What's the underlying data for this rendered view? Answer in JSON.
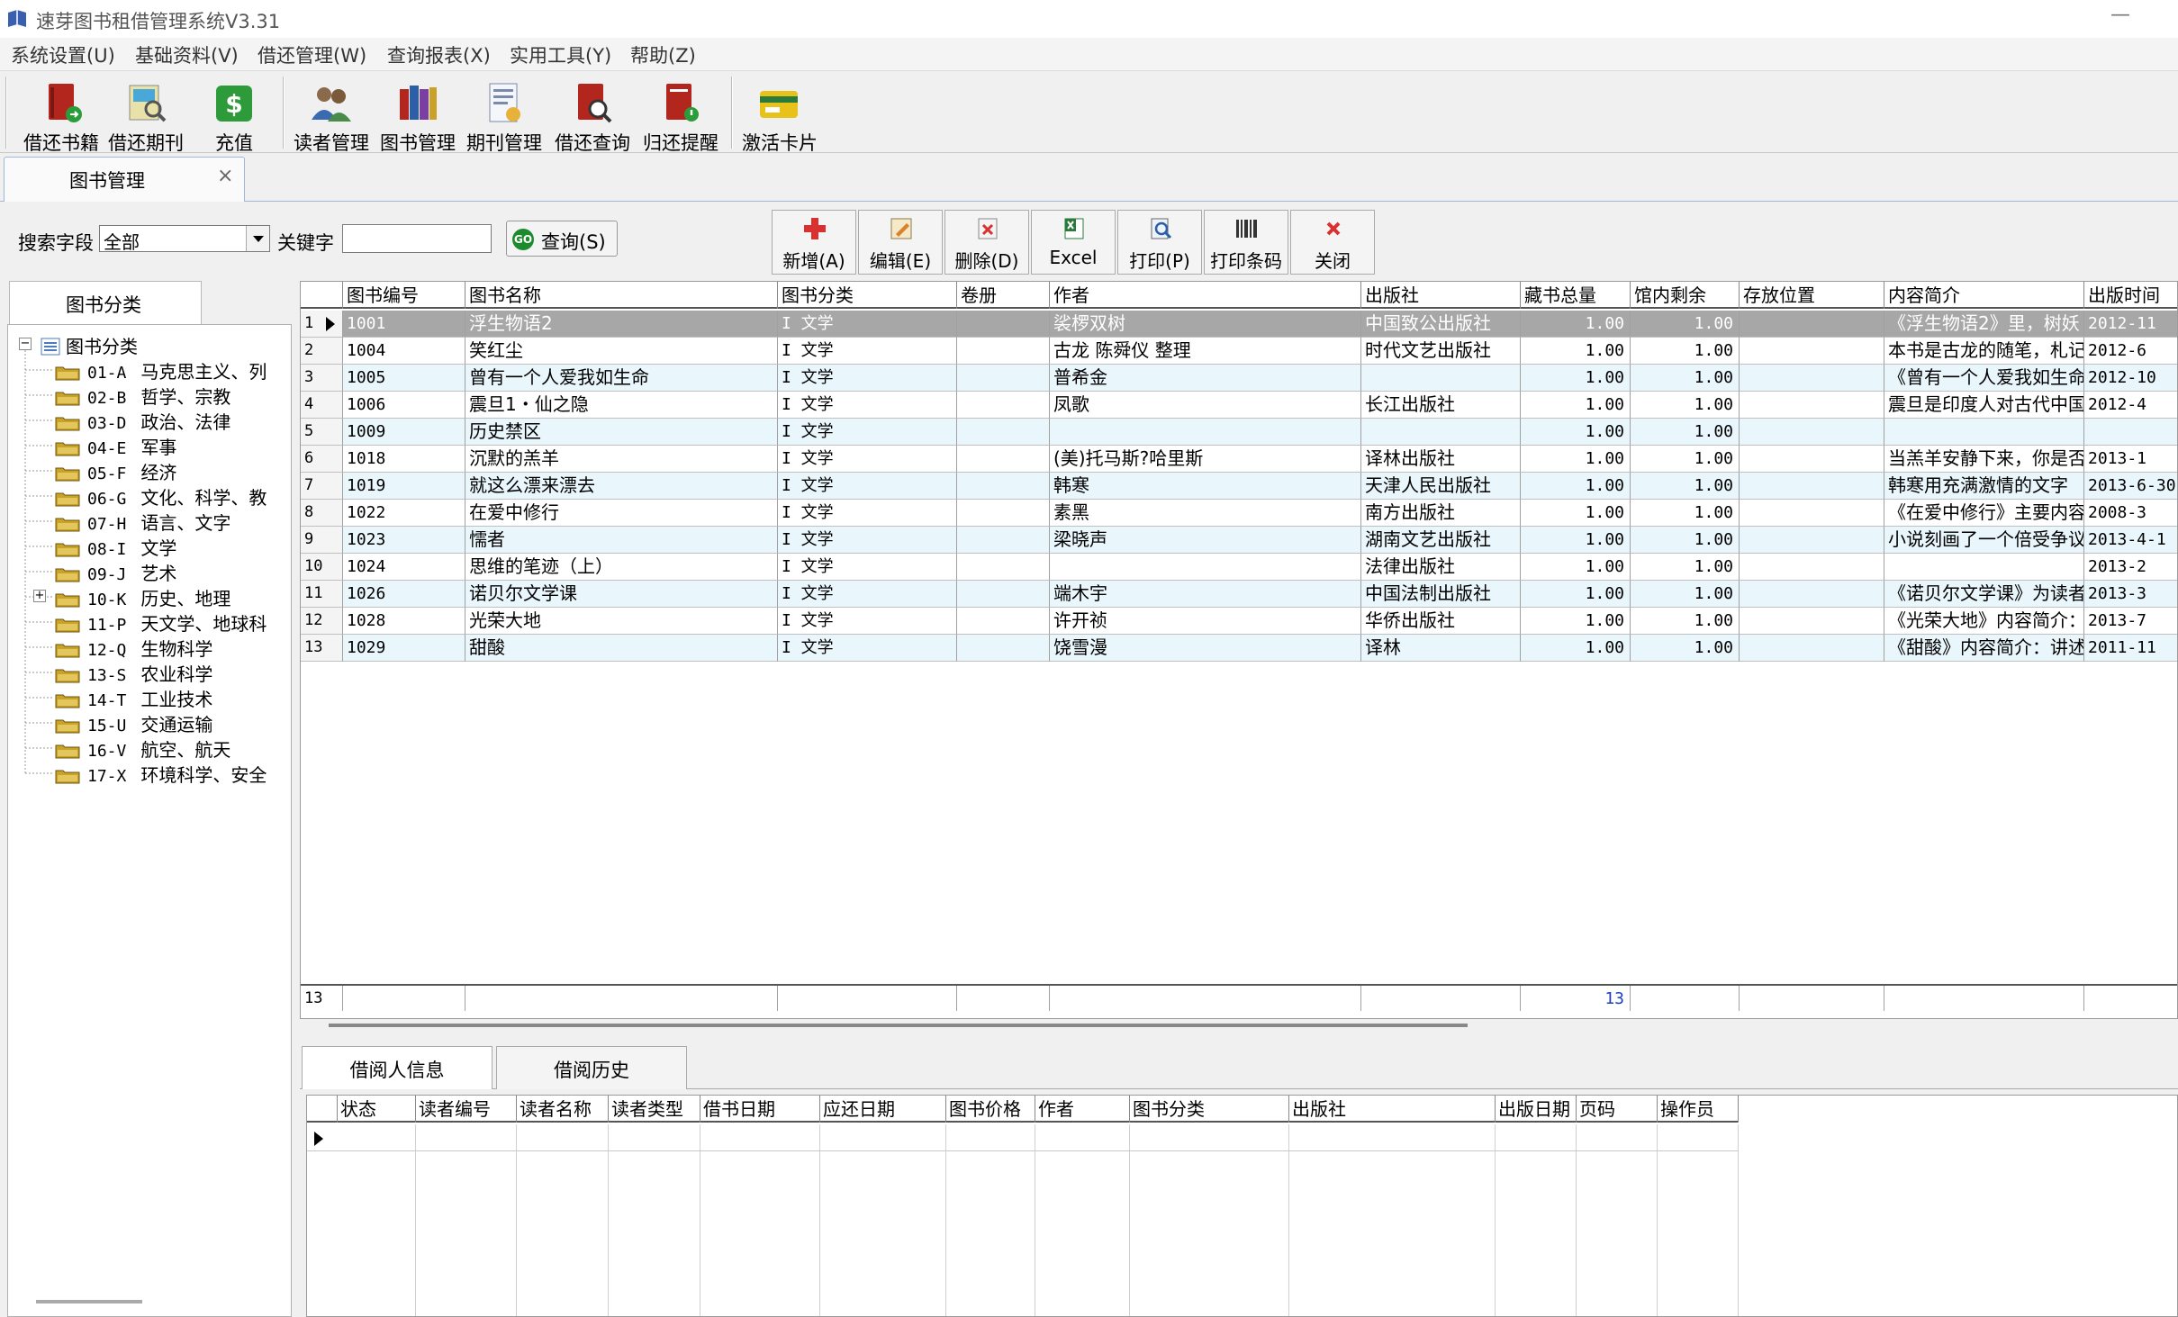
{
  "window": {
    "title": "速芽图书租借管理系统V3.31",
    "minimize_glyph": "—"
  },
  "menu": [
    "系统设置(U)",
    "基础资料(V)",
    "借还管理(W)",
    "查询报表(X)",
    "实用工具(Y)",
    "帮助(Z)"
  ],
  "toolbar": [
    {
      "label": "借还书籍",
      "icon": "book-return-icon"
    },
    {
      "label": "借还期刊",
      "icon": "magazine-icon"
    },
    {
      "label": "充值",
      "icon": "dollar-icon"
    },
    {
      "label": "读者管理",
      "icon": "readers-icon"
    },
    {
      "label": "图书管理",
      "icon": "books-icon"
    },
    {
      "label": "期刊管理",
      "icon": "periodical-icon"
    },
    {
      "label": "借还查询",
      "icon": "search-book-icon"
    },
    {
      "label": "归还提醒",
      "icon": "reminder-icon"
    },
    {
      "label": "激活卡片",
      "icon": "card-icon"
    }
  ],
  "doc_tab": {
    "label": "图书管理",
    "close": "×"
  },
  "search": {
    "field_label": "搜索字段",
    "field_value": "全部",
    "keyword_label": "关键字",
    "keyword_value": "",
    "query_label": "查询(S)",
    "query_icon_text": "GO"
  },
  "actions": [
    {
      "label": "新增(A)",
      "icon": "add-icon"
    },
    {
      "label": "编辑(E)",
      "icon": "edit-icon"
    },
    {
      "label": "删除(D)",
      "icon": "delete-icon"
    },
    {
      "label": "Excel",
      "icon": "excel-icon"
    },
    {
      "label": "打印(P)",
      "icon": "print-icon"
    },
    {
      "label": "打印条码",
      "icon": "barcode-icon"
    },
    {
      "label": "关闭",
      "icon": "close-icon"
    }
  ],
  "category_panel": {
    "tab_label": "图书分类",
    "root": "图书分类",
    "items": [
      {
        "code": "01-A",
        "name": "马克思主义、列"
      },
      {
        "code": "02-B",
        "name": "哲学、宗教"
      },
      {
        "code": "03-D",
        "name": "政治、法律"
      },
      {
        "code": "04-E",
        "name": "军事"
      },
      {
        "code": "05-F",
        "name": "经济"
      },
      {
        "code": "06-G",
        "name": "文化、科学、教"
      },
      {
        "code": "07-H",
        "name": "语言、文字"
      },
      {
        "code": "08-I",
        "name": "文学"
      },
      {
        "code": "09-J",
        "name": "艺术"
      },
      {
        "code": "10-K",
        "name": "历史、地理",
        "expandable": true
      },
      {
        "code": "11-P",
        "name": "天文学、地球科"
      },
      {
        "code": "12-Q",
        "name": "生物科学"
      },
      {
        "code": "13-S",
        "name": "农业科学"
      },
      {
        "code": "14-T",
        "name": "工业技术"
      },
      {
        "code": "15-U",
        "name": "交通运输"
      },
      {
        "code": "16-V",
        "name": "航空、航天"
      },
      {
        "code": "17-X",
        "name": "环境科学、安全"
      }
    ]
  },
  "book_grid": {
    "columns": [
      "图书编号",
      "图书名称",
      "图书分类",
      "卷册",
      "作者",
      "出版社",
      "藏书总量",
      "馆内剩余",
      "存放位置",
      "内容简介",
      "出版时间"
    ],
    "rows": [
      {
        "n": "1",
        "id": "1001",
        "name": "浮生物语2",
        "cls": "I  文学",
        "vol": "",
        "author": "裟椤双树",
        "pub": "中国致公出版社",
        "total": "1.00",
        "remain": "1.00",
        "loc": "",
        "desc": "《浮生物语2》里，树妖",
        "date": "2012-11"
      },
      {
        "n": "2",
        "id": "1004",
        "name": "笑红尘",
        "cls": "I  文学",
        "vol": "",
        "author": "古龙 陈舜仪 整理",
        "pub": "时代文艺出版社",
        "total": "1.00",
        "remain": "1.00",
        "loc": "",
        "desc": "本书是古龙的随笔，札记",
        "date": "2012-6"
      },
      {
        "n": "3",
        "id": "1005",
        "name": "曾有一个人爱我如生命",
        "cls": "I  文学",
        "vol": "",
        "author": "普希金",
        "pub": "",
        "total": "1.00",
        "remain": "1.00",
        "loc": "",
        "desc": "《曾有一个人爱我如生命",
        "date": "2012-10"
      },
      {
        "n": "4",
        "id": "1006",
        "name": "震旦1・仙之隐",
        "cls": "I  文学",
        "vol": "",
        "author": "凤歌",
        "pub": "长江出版社",
        "total": "1.00",
        "remain": "1.00",
        "loc": "",
        "desc": "震旦是印度人对古代中国",
        "date": "2012-4"
      },
      {
        "n": "5",
        "id": "1009",
        "name": "历史禁区",
        "cls": "I  文学",
        "vol": "",
        "author": "",
        "pub": "",
        "total": "1.00",
        "remain": "1.00",
        "loc": "",
        "desc": "",
        "date": ""
      },
      {
        "n": "6",
        "id": "1018",
        "name": "沉默的羔羊",
        "cls": "I  文学",
        "vol": "",
        "author": "(美)托马斯?哈里斯",
        "pub": "译林出版社",
        "total": "1.00",
        "remain": "1.00",
        "loc": "",
        "desc": "当羔羊安静下来，你是否",
        "date": "2013-1"
      },
      {
        "n": "7",
        "id": "1019",
        "name": "就这么漂来漂去",
        "cls": "I  文学",
        "vol": "",
        "author": "韩寒",
        "pub": "天津人民出版社",
        "total": "1.00",
        "remain": "1.00",
        "loc": "",
        "desc": "韩寒用充满激情的文字",
        "date": "2013-6-30"
      },
      {
        "n": "8",
        "id": "1022",
        "name": "在爱中修行",
        "cls": "I  文学",
        "vol": "",
        "author": "素黑",
        "pub": "南方出版社",
        "total": "1.00",
        "remain": "1.00",
        "loc": "",
        "desc": "《在爱中修行》主要内容",
        "date": "2008-3"
      },
      {
        "n": "9",
        "id": "1023",
        "name": "懦者",
        "cls": "I  文学",
        "vol": "",
        "author": "梁晓声",
        "pub": "湖南文艺出版社",
        "total": "1.00",
        "remain": "1.00",
        "loc": "",
        "desc": "小说刻画了一个倍受争议",
        "date": "2013-4-1"
      },
      {
        "n": "10",
        "id": "1024",
        "name": "思维的笔迹（上）",
        "cls": "I  文学",
        "vol": "",
        "author": "",
        "pub": "法律出版社",
        "total": "1.00",
        "remain": "1.00",
        "loc": "",
        "desc": "",
        "date": "2013-2"
      },
      {
        "n": "11",
        "id": "1026",
        "name": "诺贝尔文学课",
        "cls": "I  文学",
        "vol": "",
        "author": "端木宇",
        "pub": "中国法制出版社",
        "total": "1.00",
        "remain": "1.00",
        "loc": "",
        "desc": "《诺贝尔文学课》为读者",
        "date": "2013-3"
      },
      {
        "n": "12",
        "id": "1028",
        "name": "光荣大地",
        "cls": "I  文学",
        "vol": "",
        "author": "许开祯",
        "pub": "华侨出版社",
        "total": "1.00",
        "remain": "1.00",
        "loc": "",
        "desc": "《光荣大地》内容简介：",
        "date": "2013-7"
      },
      {
        "n": "13",
        "id": "1029",
        "name": "甜酸",
        "cls": "I  文学",
        "vol": "",
        "author": "饶雪漫",
        "pub": "译林",
        "total": "1.00",
        "remain": "1.00",
        "loc": "",
        "desc": "《甜酸》内容简介：讲述",
        "date": "2011-11"
      }
    ],
    "footer_count": "13",
    "footer_total": "13"
  },
  "bottom_tabs": [
    "借阅人信息",
    "借阅历史"
  ],
  "borrow_grid": {
    "columns": [
      "状态",
      "读者编号",
      "读者名称",
      "读者类型",
      "借书日期",
      "应还日期",
      "图书价格",
      "作者",
      "图书分类",
      "出版社",
      "出版日期",
      "页码",
      "操作员"
    ]
  },
  "colors": {
    "selected_row": "#a7a7a7",
    "alt_row": "#e9f6fb",
    "footer_total": "#1a3fbf"
  }
}
